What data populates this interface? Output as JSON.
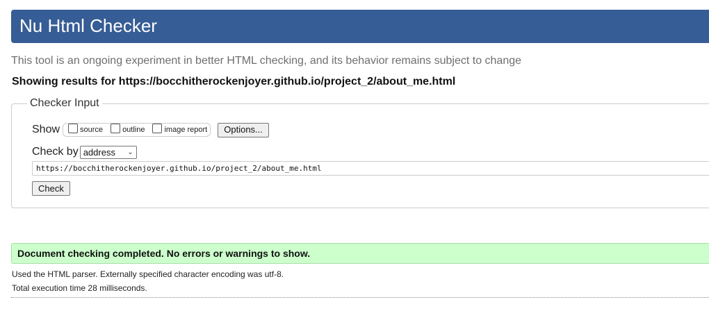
{
  "header": {
    "title": "Nu Html Checker"
  },
  "tagline": "This tool is an ongoing experiment in better HTML checking, and its behavior remains subject to change",
  "showing": "Showing results for https://bocchitherockenjoyer.github.io/project_2/about_me.html",
  "checker_input": {
    "legend": "Checker Input",
    "show_label": "Show",
    "options": [
      {
        "label": "source",
        "checked": false
      },
      {
        "label": "outline",
        "checked": false
      },
      {
        "label": "image report",
        "checked": false
      }
    ],
    "options_button": "Options...",
    "check_by_label": "Check by",
    "check_by_selected": "address",
    "url_value": "https://bocchitherockenjoyer.github.io/project_2/about_me.html",
    "check_button": "Check"
  },
  "results": {
    "success_message": "Document checking completed. No errors or warnings to show.",
    "parser_note": "Used the HTML parser. Externally specified character encoding was utf-8.",
    "time_note": "Total execution time 28 milliseconds."
  },
  "colors": {
    "header_bg": "#365d95",
    "success_bg": "#ccffcc"
  }
}
